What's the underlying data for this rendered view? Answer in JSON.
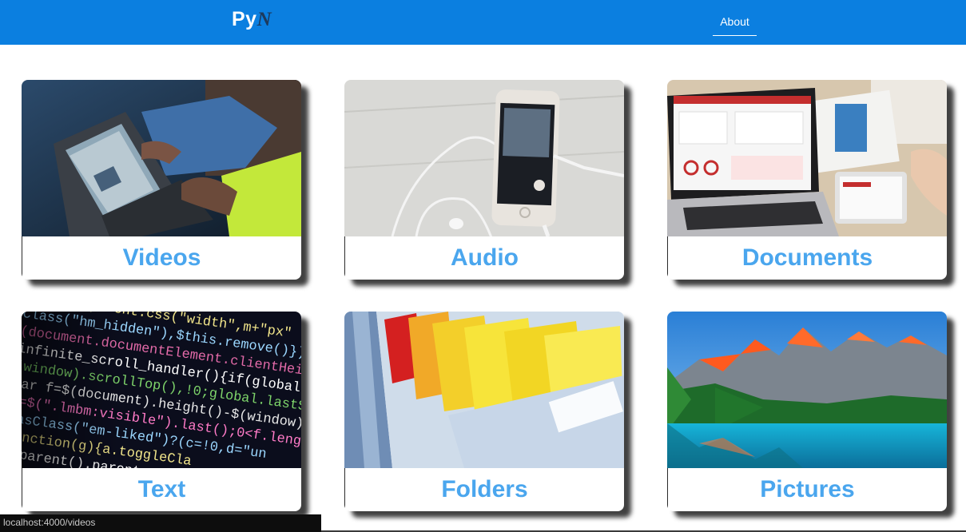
{
  "navbar": {
    "brand_main": "Py",
    "brand_accent": "N",
    "about_label": "About",
    "bg_color": "#0b7fe0"
  },
  "cards": [
    {
      "label": "Videos",
      "image": "laptop-video-photo"
    },
    {
      "label": "Audio",
      "image": "phone-earphones-photo"
    },
    {
      "label": "Documents",
      "image": "laptop-dashboard-photo"
    },
    {
      "label": "Text",
      "image": "source-code-photo"
    },
    {
      "label": "Folders",
      "image": "file-drawer-folders-photo"
    },
    {
      "label": "Pictures",
      "image": "mountain-lake-photo"
    }
  ],
  "label_color": "#4aa6ee",
  "status_bar": {
    "url": "localhost:4000/videos"
  }
}
